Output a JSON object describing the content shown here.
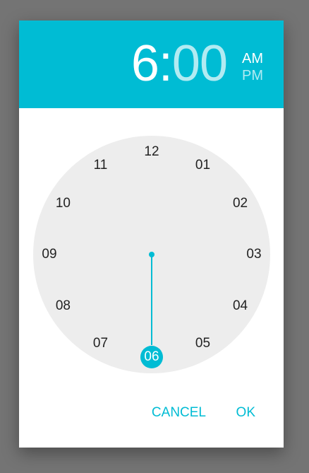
{
  "header": {
    "hour": "6",
    "separator": ":",
    "minute": "00",
    "am_label": "AM",
    "pm_label": "PM"
  },
  "clock": {
    "selected": "06",
    "numbers": [
      "12",
      "01",
      "02",
      "03",
      "04",
      "05",
      "06",
      "07",
      "08",
      "09",
      "10",
      "11"
    ]
  },
  "actions": {
    "cancel_label": "CANCEL",
    "ok_label": "OK"
  },
  "colors": {
    "accent": "#00bcd4",
    "accent_light": "#b2ebf2",
    "clock_face": "#ededed",
    "backdrop": "#747474"
  }
}
